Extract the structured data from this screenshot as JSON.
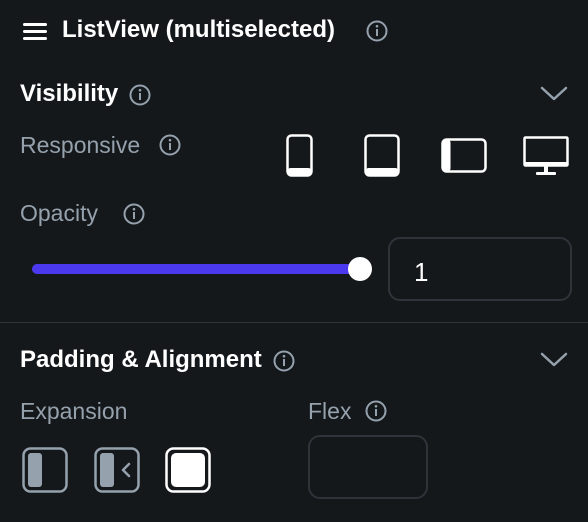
{
  "header": {
    "title": "ListView (multiselected)"
  },
  "visibility": {
    "title": "Visibility",
    "responsive_label": "Responsive",
    "opacity_label": "Opacity",
    "opacity_value": "1",
    "opacity_fraction": 1.0,
    "devices": [
      "phone-icon",
      "tablet-icon",
      "tablet-landscape-icon",
      "desktop-icon"
    ]
  },
  "padding_alignment": {
    "title": "Padding & Alignment",
    "expansion_label": "Expansion",
    "flex_label": "Flex",
    "flex_value": "",
    "expansion_options": [
      "expansion-fill-left-icon",
      "expansion-collapse-left-icon",
      "expansion-full-icon"
    ],
    "selected_expansion": "expansion-full-icon"
  },
  "colors": {
    "background": "#14181b",
    "accent": "#4b39ef",
    "muted_text": "#95a1ac",
    "border": "#2e343a",
    "text": "#ffffff"
  }
}
